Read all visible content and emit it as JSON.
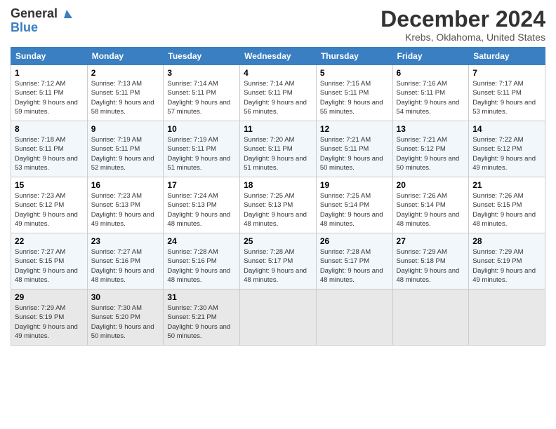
{
  "header": {
    "logo_general": "General",
    "logo_blue": "Blue",
    "month_title": "December 2024",
    "subtitle": "Krebs, Oklahoma, United States"
  },
  "weekdays": [
    "Sunday",
    "Monday",
    "Tuesday",
    "Wednesday",
    "Thursday",
    "Friday",
    "Saturday"
  ],
  "weeks": [
    [
      {
        "day": "1",
        "sunrise": "Sunrise: 7:12 AM",
        "sunset": "Sunset: 5:11 PM",
        "daylight": "Daylight: 9 hours and 59 minutes."
      },
      {
        "day": "2",
        "sunrise": "Sunrise: 7:13 AM",
        "sunset": "Sunset: 5:11 PM",
        "daylight": "Daylight: 9 hours and 58 minutes."
      },
      {
        "day": "3",
        "sunrise": "Sunrise: 7:14 AM",
        "sunset": "Sunset: 5:11 PM",
        "daylight": "Daylight: 9 hours and 57 minutes."
      },
      {
        "day": "4",
        "sunrise": "Sunrise: 7:14 AM",
        "sunset": "Sunset: 5:11 PM",
        "daylight": "Daylight: 9 hours and 56 minutes."
      },
      {
        "day": "5",
        "sunrise": "Sunrise: 7:15 AM",
        "sunset": "Sunset: 5:11 PM",
        "daylight": "Daylight: 9 hours and 55 minutes."
      },
      {
        "day": "6",
        "sunrise": "Sunrise: 7:16 AM",
        "sunset": "Sunset: 5:11 PM",
        "daylight": "Daylight: 9 hours and 54 minutes."
      },
      {
        "day": "7",
        "sunrise": "Sunrise: 7:17 AM",
        "sunset": "Sunset: 5:11 PM",
        "daylight": "Daylight: 9 hours and 53 minutes."
      }
    ],
    [
      {
        "day": "8",
        "sunrise": "Sunrise: 7:18 AM",
        "sunset": "Sunset: 5:11 PM",
        "daylight": "Daylight: 9 hours and 53 minutes."
      },
      {
        "day": "9",
        "sunrise": "Sunrise: 7:19 AM",
        "sunset": "Sunset: 5:11 PM",
        "daylight": "Daylight: 9 hours and 52 minutes."
      },
      {
        "day": "10",
        "sunrise": "Sunrise: 7:19 AM",
        "sunset": "Sunset: 5:11 PM",
        "daylight": "Daylight: 9 hours and 51 minutes."
      },
      {
        "day": "11",
        "sunrise": "Sunrise: 7:20 AM",
        "sunset": "Sunset: 5:11 PM",
        "daylight": "Daylight: 9 hours and 51 minutes."
      },
      {
        "day": "12",
        "sunrise": "Sunrise: 7:21 AM",
        "sunset": "Sunset: 5:11 PM",
        "daylight": "Daylight: 9 hours and 50 minutes."
      },
      {
        "day": "13",
        "sunrise": "Sunrise: 7:21 AM",
        "sunset": "Sunset: 5:12 PM",
        "daylight": "Daylight: 9 hours and 50 minutes."
      },
      {
        "day": "14",
        "sunrise": "Sunrise: 7:22 AM",
        "sunset": "Sunset: 5:12 PM",
        "daylight": "Daylight: 9 hours and 49 minutes."
      }
    ],
    [
      {
        "day": "15",
        "sunrise": "Sunrise: 7:23 AM",
        "sunset": "Sunset: 5:12 PM",
        "daylight": "Daylight: 9 hours and 49 minutes."
      },
      {
        "day": "16",
        "sunrise": "Sunrise: 7:23 AM",
        "sunset": "Sunset: 5:13 PM",
        "daylight": "Daylight: 9 hours and 49 minutes."
      },
      {
        "day": "17",
        "sunrise": "Sunrise: 7:24 AM",
        "sunset": "Sunset: 5:13 PM",
        "daylight": "Daylight: 9 hours and 48 minutes."
      },
      {
        "day": "18",
        "sunrise": "Sunrise: 7:25 AM",
        "sunset": "Sunset: 5:13 PM",
        "daylight": "Daylight: 9 hours and 48 minutes."
      },
      {
        "day": "19",
        "sunrise": "Sunrise: 7:25 AM",
        "sunset": "Sunset: 5:14 PM",
        "daylight": "Daylight: 9 hours and 48 minutes."
      },
      {
        "day": "20",
        "sunrise": "Sunrise: 7:26 AM",
        "sunset": "Sunset: 5:14 PM",
        "daylight": "Daylight: 9 hours and 48 minutes."
      },
      {
        "day": "21",
        "sunrise": "Sunrise: 7:26 AM",
        "sunset": "Sunset: 5:15 PM",
        "daylight": "Daylight: 9 hours and 48 minutes."
      }
    ],
    [
      {
        "day": "22",
        "sunrise": "Sunrise: 7:27 AM",
        "sunset": "Sunset: 5:15 PM",
        "daylight": "Daylight: 9 hours and 48 minutes."
      },
      {
        "day": "23",
        "sunrise": "Sunrise: 7:27 AM",
        "sunset": "Sunset: 5:16 PM",
        "daylight": "Daylight: 9 hours and 48 minutes."
      },
      {
        "day": "24",
        "sunrise": "Sunrise: 7:28 AM",
        "sunset": "Sunset: 5:16 PM",
        "daylight": "Daylight: 9 hours and 48 minutes."
      },
      {
        "day": "25",
        "sunrise": "Sunrise: 7:28 AM",
        "sunset": "Sunset: 5:17 PM",
        "daylight": "Daylight: 9 hours and 48 minutes."
      },
      {
        "day": "26",
        "sunrise": "Sunrise: 7:28 AM",
        "sunset": "Sunset: 5:17 PM",
        "daylight": "Daylight: 9 hours and 48 minutes."
      },
      {
        "day": "27",
        "sunrise": "Sunrise: 7:29 AM",
        "sunset": "Sunset: 5:18 PM",
        "daylight": "Daylight: 9 hours and 48 minutes."
      },
      {
        "day": "28",
        "sunrise": "Sunrise: 7:29 AM",
        "sunset": "Sunset: 5:19 PM",
        "daylight": "Daylight: 9 hours and 49 minutes."
      }
    ],
    [
      {
        "day": "29",
        "sunrise": "Sunrise: 7:29 AM",
        "sunset": "Sunset: 5:19 PM",
        "daylight": "Daylight: 9 hours and 49 minutes."
      },
      {
        "day": "30",
        "sunrise": "Sunrise: 7:30 AM",
        "sunset": "Sunset: 5:20 PM",
        "daylight": "Daylight: 9 hours and 50 minutes."
      },
      {
        "day": "31",
        "sunrise": "Sunrise: 7:30 AM",
        "sunset": "Sunset: 5:21 PM",
        "daylight": "Daylight: 9 hours and 50 minutes."
      },
      null,
      null,
      null,
      null
    ]
  ]
}
